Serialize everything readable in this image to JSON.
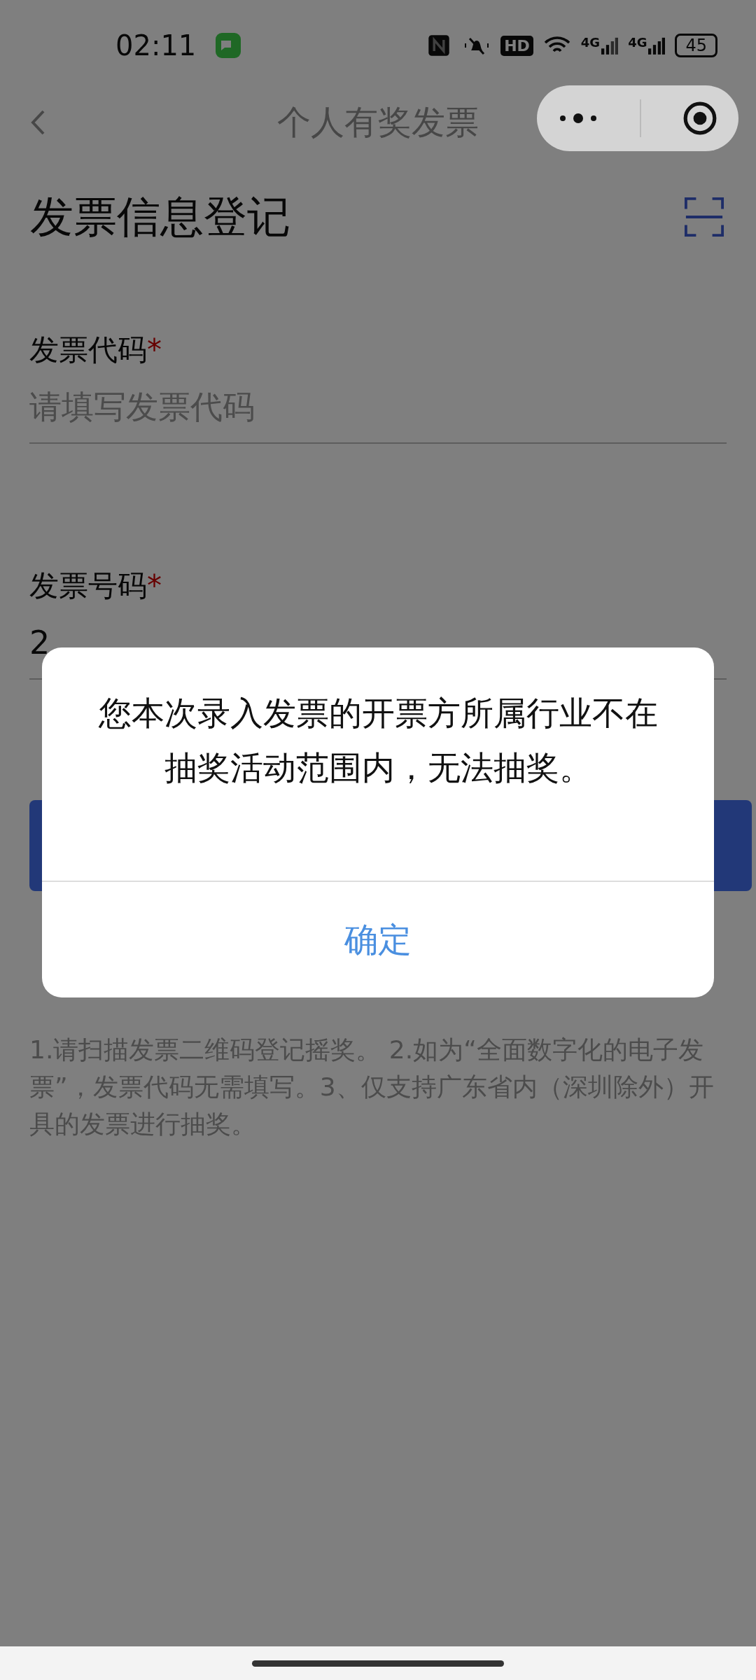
{
  "status_bar": {
    "time": "02:11",
    "hd": "HD",
    "networks": [
      "4G",
      "4G"
    ],
    "battery": "45"
  },
  "nav": {
    "title": "个人有奖发票"
  },
  "heading": "发票信息登记",
  "fields": [
    {
      "label": "发票代码",
      "required_mark": "*",
      "placeholder": "请填写发票代码"
    },
    {
      "label": "发票号码",
      "required_mark": "*",
      "value": "2"
    }
  ],
  "tips": "1.请扫描发票二维码登记摇奖。 2.如为“全面数字化的电子发票”，发票代码无需填写。3、仅支持广东省内（深圳除外）开具的发票进行抽奖。",
  "dialog": {
    "message": "您本次录入发票的开票方所属行业不在抽奖活动范围内，无法抽奖。",
    "button": "确定"
  }
}
